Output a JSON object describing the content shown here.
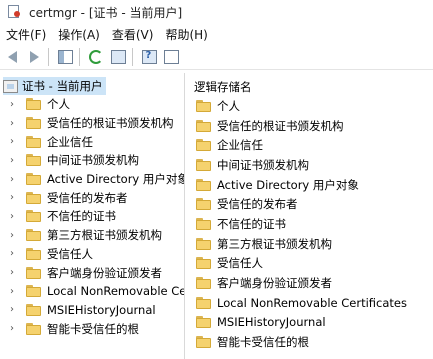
{
  "window": {
    "title": "certmgr - [证书 - 当前用户]"
  },
  "menu": [
    "文件(F)",
    "操作(A)",
    "查看(V)",
    "帮助(H)"
  ],
  "tree": {
    "root": "证书 - 当前用户",
    "items": [
      "个人",
      "受信任的根证书颁发机构",
      "企业信任",
      "中间证书颁发机构",
      "Active Directory 用户对象",
      "受信任的发布者",
      "不信任的证书",
      "第三方根证书颁发机构",
      "受信任人",
      "客户端身份验证颁发者",
      "Local NonRemovable Cert",
      "MSIEHistoryJournal",
      "智能卡受信任的根"
    ]
  },
  "list": {
    "header": "逻辑存储名",
    "items": [
      "个人",
      "受信任的根证书颁发机构",
      "企业信任",
      "中间证书颁发机构",
      "Active Directory 用户对象",
      "受信任的发布者",
      "不信任的证书",
      "第三方根证书颁发机构",
      "受信任人",
      "客户端身份验证颁发者",
      "Local NonRemovable Certificates",
      "MSIEHistoryJournal",
      "智能卡受信任的根"
    ]
  }
}
